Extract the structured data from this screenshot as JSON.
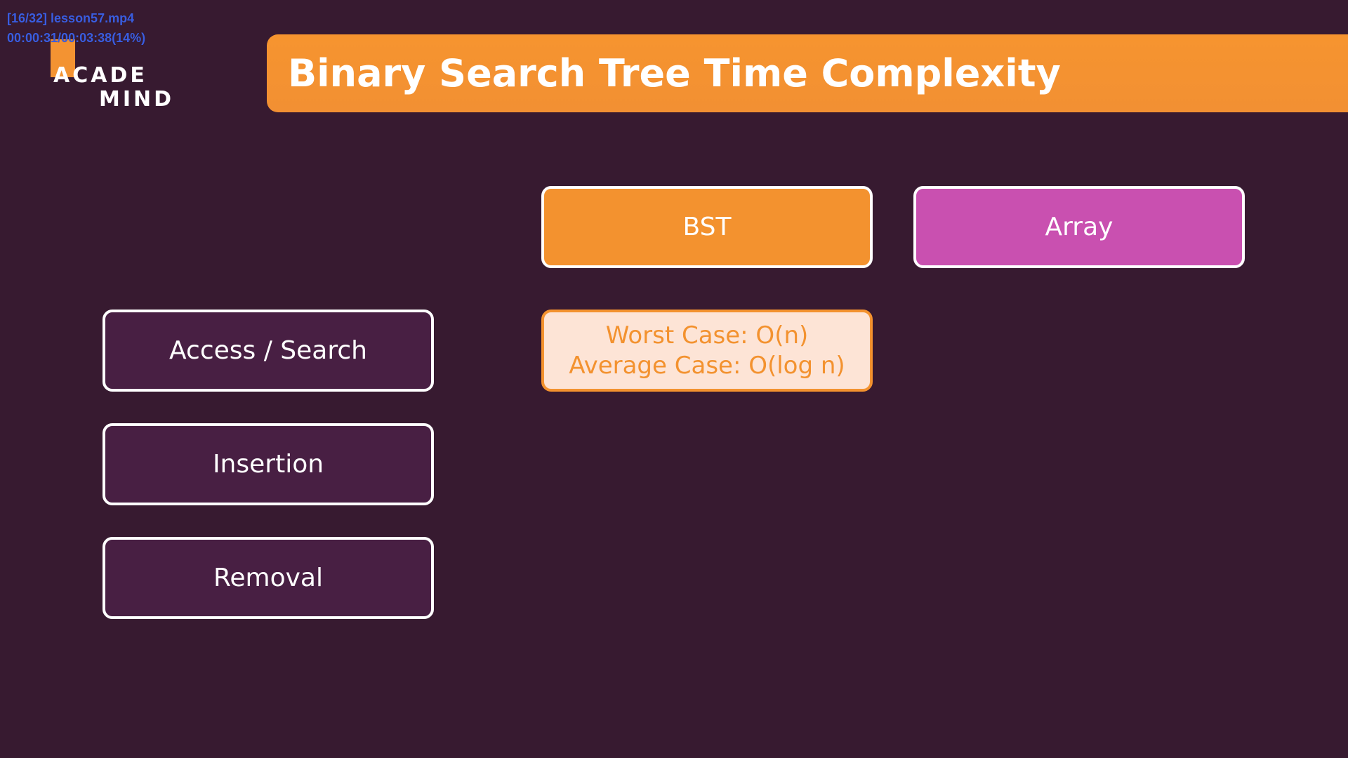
{
  "player_overlay": {
    "file": "[16/32] lesson57.mp4",
    "timecode": "00:00:31/00:03:38(14%)"
  },
  "logo": {
    "line1": "ACADE",
    "line2": "MIND"
  },
  "slide": {
    "title": "Binary Search Tree Time Complexity",
    "columns": [
      "BST",
      "Array"
    ],
    "rows": [
      "Access / Search",
      "Insertion",
      "Removal"
    ],
    "cells": {
      "bst_access_search": {
        "line1": "Worst Case: O(n)",
        "line2": "Average Case: O(log n)"
      }
    }
  },
  "colors": {
    "background": "#371a30",
    "accent_orange": "#f3922f",
    "accent_pink": "#c950b0",
    "row_fill": "#481f43",
    "cell_fill": "#fde4d6",
    "overlay_text": "#3a5de0"
  }
}
